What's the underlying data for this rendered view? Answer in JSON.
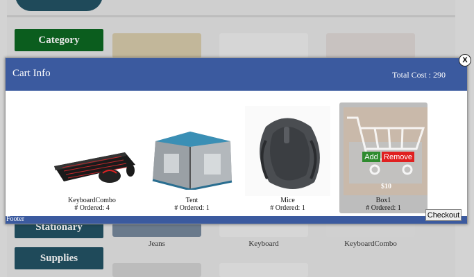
{
  "background": {
    "category_label": "Category",
    "stationary_label": "Stationary",
    "supplies_label": "Supplies",
    "captions": [
      "Jeans",
      "Keyboard",
      "KeyboardCombo"
    ]
  },
  "modal": {
    "title": "Cart Info",
    "total_cost": "Total Cost : 290",
    "close_label": "X",
    "footer_label": "Footer",
    "checkout_label": "Checkout",
    "items": [
      {
        "name": "KeyboardCombo",
        "ordered": "# Ordered: 4"
      },
      {
        "name": "Tent",
        "ordered": "# Ordered: 1"
      },
      {
        "name": "Mice",
        "ordered": "# Ordered: 1"
      },
      {
        "name": "Box1",
        "ordered": "# Ordered: 1",
        "price": "$10",
        "add_label": "Add",
        "remove_label": "Remove"
      }
    ]
  },
  "colors": {
    "header_blue": "#3b5a9f",
    "category_green": "#0b5d1e",
    "nav_teal": "#1f4a5a",
    "add_green": "#2e8b2e",
    "remove_red": "#e02020"
  }
}
